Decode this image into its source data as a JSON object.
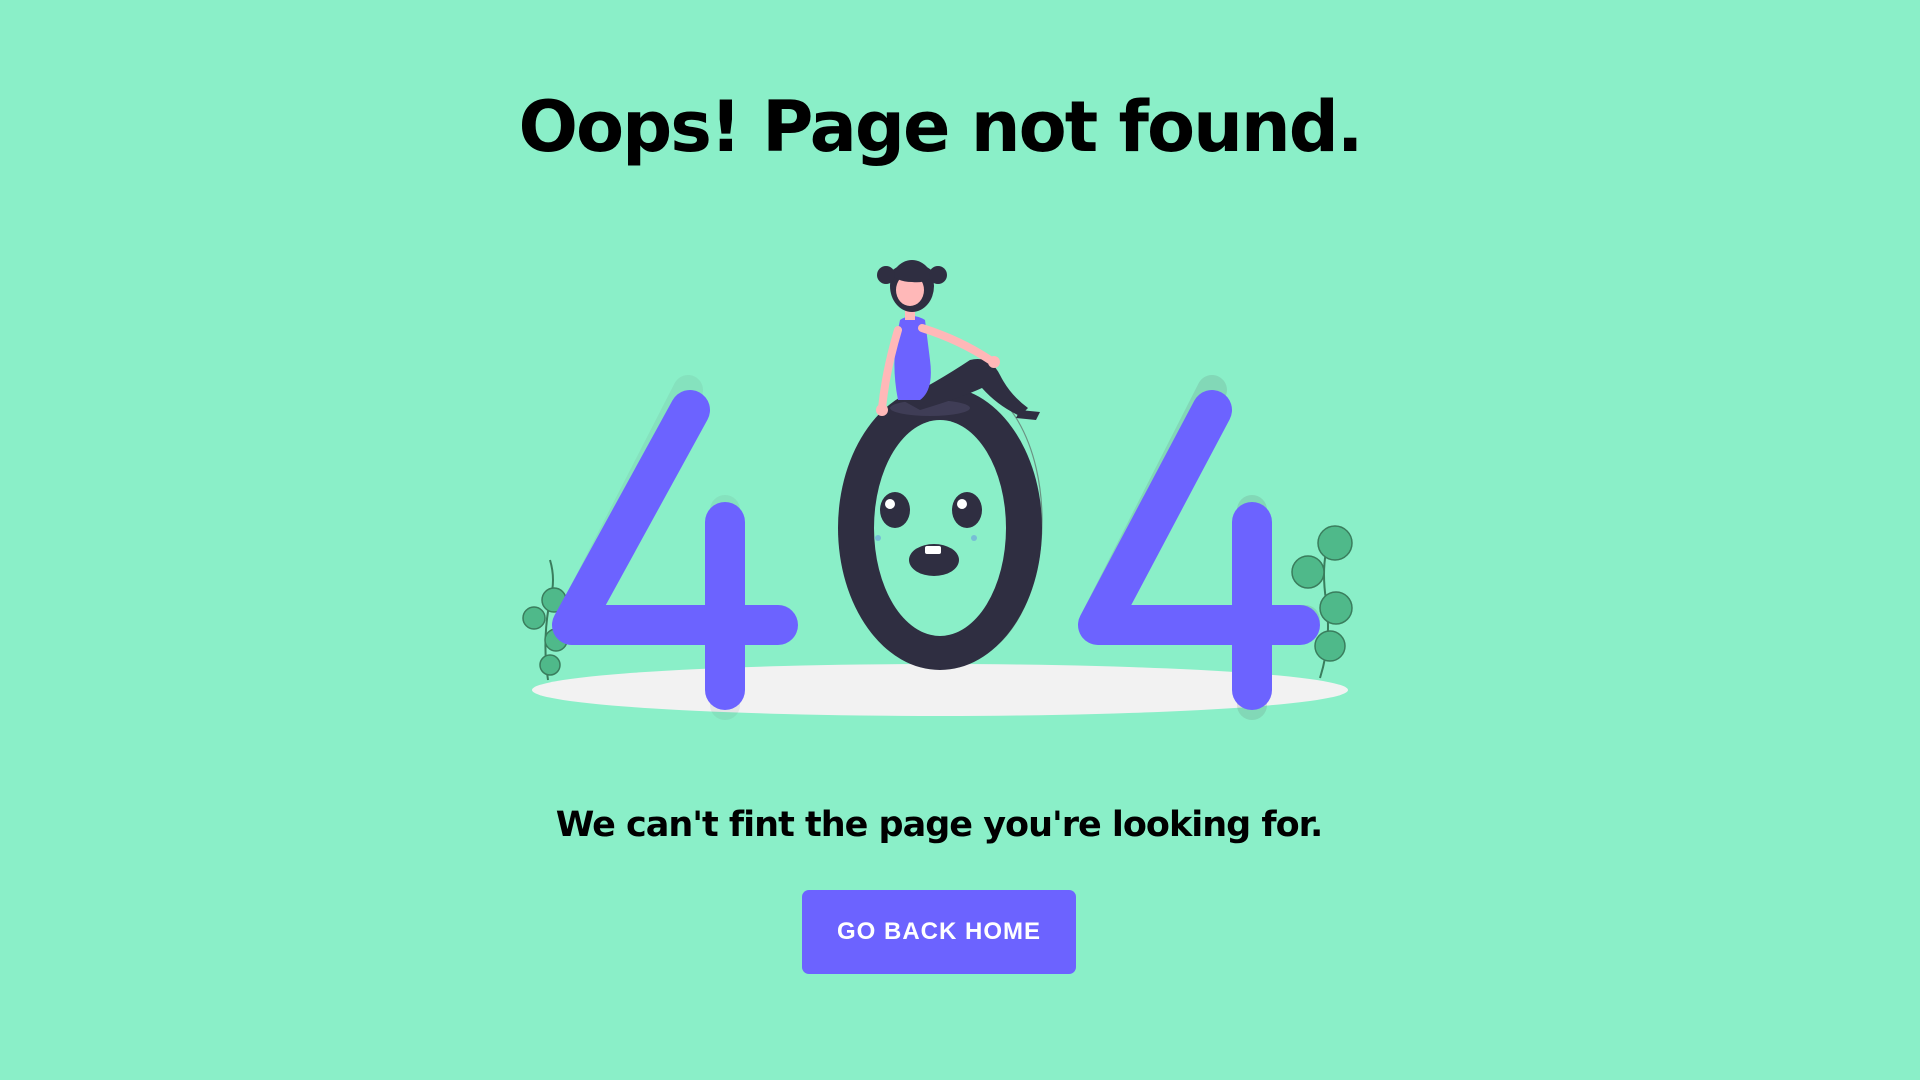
{
  "heading": "Oops! Page not found.",
  "message": "We can't fint the page you're looking for.",
  "button_label": "GO BACK HOME",
  "illustration": {
    "digits": [
      "4",
      "0",
      "4"
    ]
  },
  "colors": {
    "background": "#8aefc8",
    "accent": "#6c63ff",
    "dark": "#2f2e41",
    "ground": "#f2f2f2",
    "plant": "#4fb98a",
    "skin": "#ffb8b8"
  }
}
